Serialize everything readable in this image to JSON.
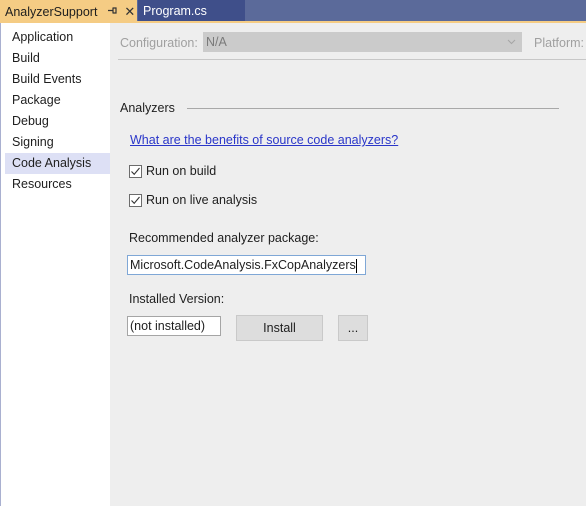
{
  "tabs": [
    {
      "label": "AnalyzerSupport",
      "active": true,
      "pin_icon": "⊣",
      "close_icon": "✕"
    },
    {
      "label": "Program.cs",
      "active": false
    }
  ],
  "sidebar": {
    "items": [
      {
        "label": "Application"
      },
      {
        "label": "Build"
      },
      {
        "label": "Build Events"
      },
      {
        "label": "Package"
      },
      {
        "label": "Debug"
      },
      {
        "label": "Signing"
      },
      {
        "label": "Code Analysis",
        "selected": true
      },
      {
        "label": "Resources"
      }
    ]
  },
  "config": {
    "configuration_label": "Configuration:",
    "configuration_value": "N/A",
    "platform_label": "Platform:"
  },
  "analyzers": {
    "group_label": "Analyzers",
    "link_text": "What are the benefits of source code analyzers?",
    "run_on_build": {
      "label": "Run on build",
      "checked": true
    },
    "run_on_live": {
      "label": "Run on live analysis",
      "checked": true
    },
    "recommended_label": "Recommended analyzer package:",
    "recommended_value": "Microsoft.CodeAnalysis.FxCopAnalyzers",
    "installed_label": "Installed Version:",
    "installed_value": "(not installed)",
    "install_button": "Install",
    "more_button": "..."
  },
  "colors": {
    "tab_active": "#f5cc84",
    "tab_strip": "#5b6a9a",
    "tab_inactive": "#3f4f8a",
    "selected_nav": "#dde0f5",
    "link": "#2a36c9"
  }
}
